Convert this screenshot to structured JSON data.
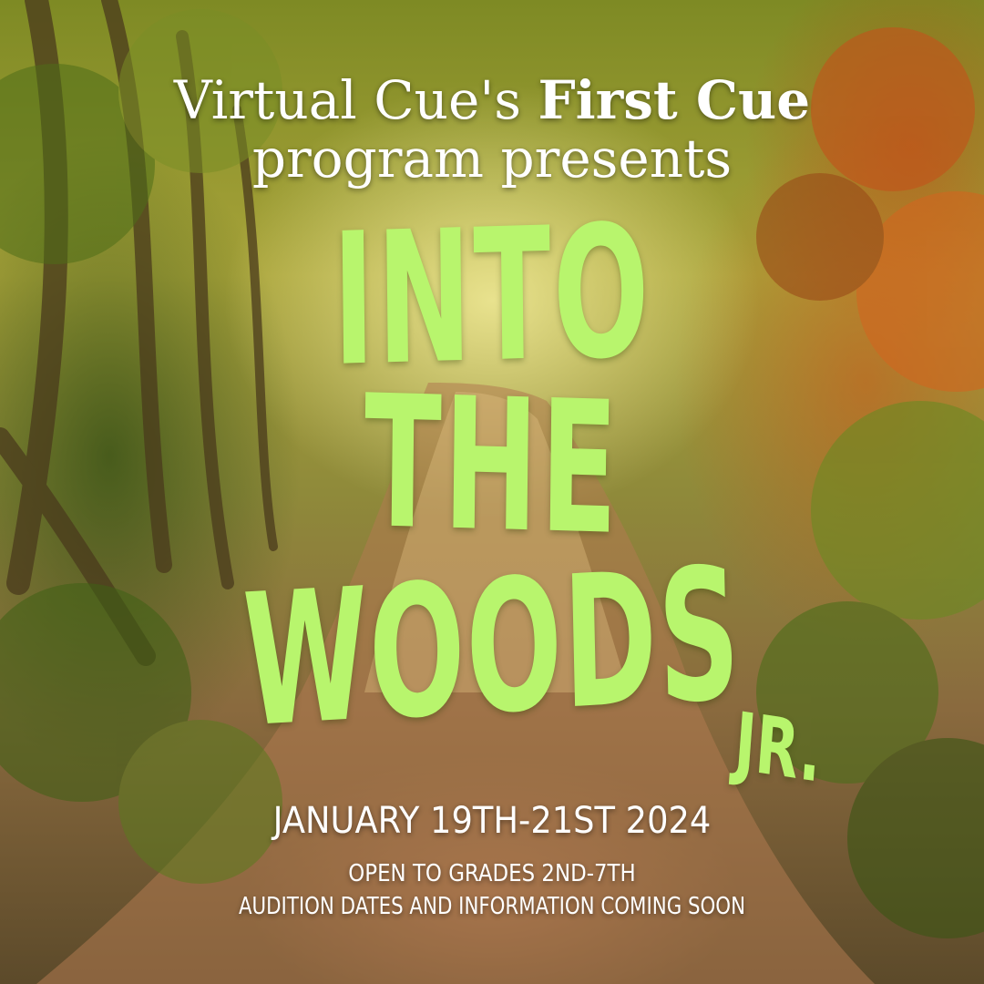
{
  "poster": {
    "intro_prefix": "Virtual Cue's ",
    "intro_bold": "First Cue",
    "intro_line2": "program presents",
    "title_line1": "INTO",
    "title_line2": "THE",
    "title_line3": "WOODS",
    "title_suffix": "JR.",
    "dates": "JANUARY 19TH-21ST 2024",
    "grades": "OPEN TO GRADES 2ND-7TH",
    "auditions": "AUDITION DATES AND INFORMATION COMING SOON"
  },
  "colors": {
    "title_green": "#b8f56d",
    "text_white": "#ffffff",
    "autumn_orange": "#cd5519",
    "forest_green": "#3c5a14"
  }
}
